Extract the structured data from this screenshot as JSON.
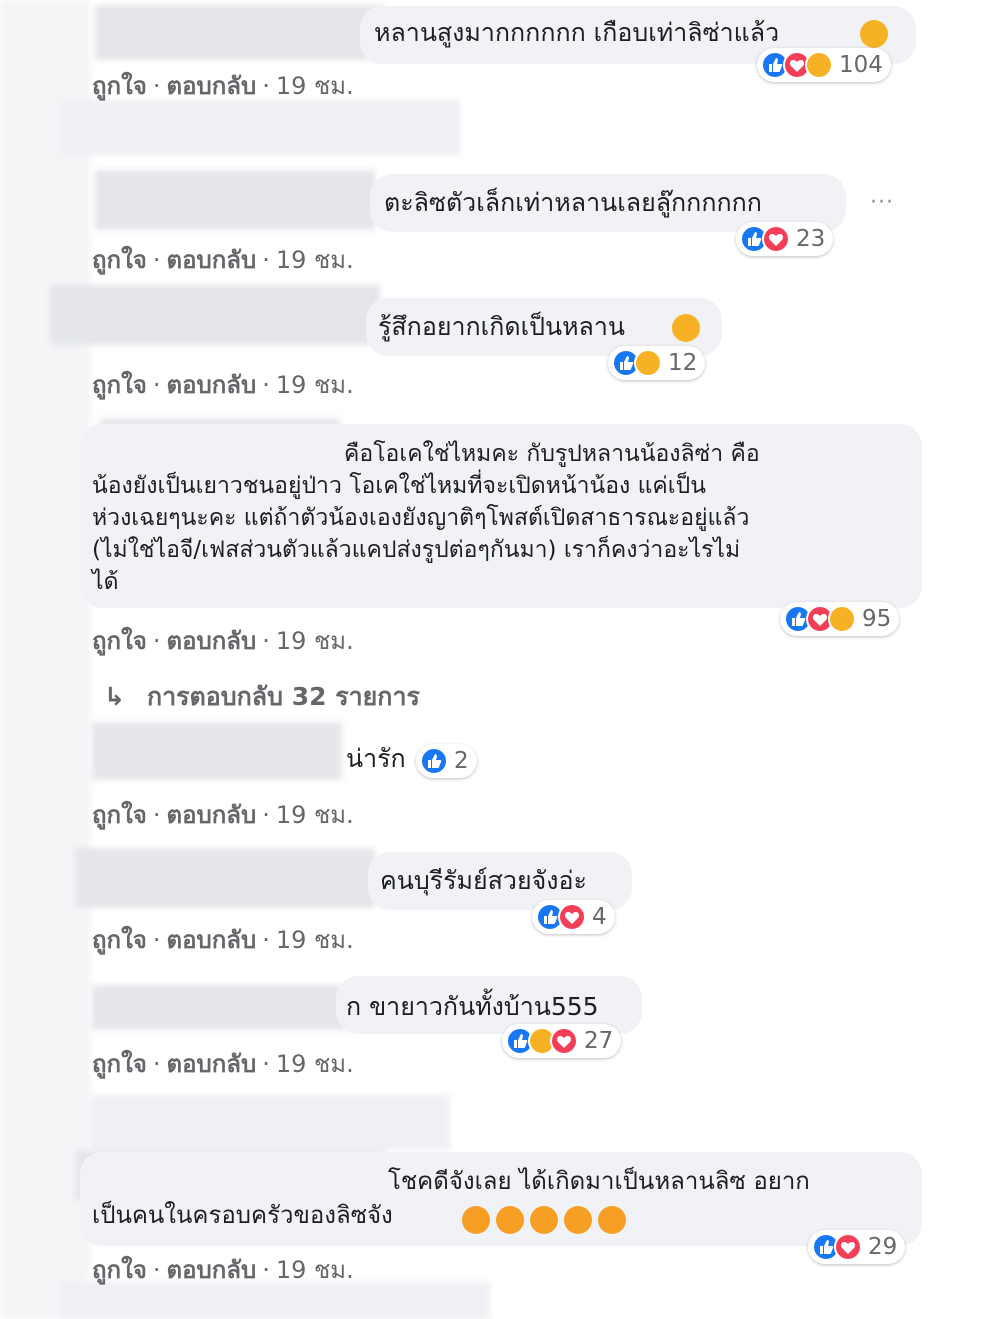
{
  "meta_labels": {
    "like": "ถูกใจ",
    "reply": "ตอบกลับ",
    "dot": "·",
    "time": "19 ชม."
  },
  "comments": [
    {
      "text": "หลานสูงมากกกกกก เกือบเท่าลิซ่าแล้ว",
      "emoji": "heart-eyes",
      "reactions": [
        "like",
        "love",
        "haha"
      ],
      "count": "104"
    },
    {
      "text": "ตะลิซตัวเล็กเท่าหลานเลยลู๊กกกกกก",
      "reactions": [
        "like",
        "love"
      ],
      "count": "23",
      "more": "···"
    },
    {
      "text": "รู้สึกอยากเกิดเป็นหลาน",
      "emoji": "laughing",
      "reactions": [
        "like",
        "haha"
      ],
      "count": "12"
    },
    {
      "text": "คือโอเคใช่ไหมคะ กับรูปหลานน้องลิซ่า คือ\nน้องยังเป็นเยาวชนอยู่ป่าว โอเคใช่ไหมที่จะเปิดหน้าน้อง แค่เป็น\nห่วงเฉยๆนะคะ แต่ถ้าตัวน้องเองยังญาติๆโพสต์เปิดสาธารณะอยู่แล้ว\n(ไม่ใช่ไอจี/เฟสส่วนตัวแล้วแคปส่งรูปต่อๆกันมา) เราก็คงว่าอะไรไม่\nได้",
      "reactions": [
        "like",
        "love",
        "haha"
      ],
      "count": "95"
    },
    {
      "text": "น่ารัก",
      "reactions": [
        "like"
      ],
      "count": "2"
    },
    {
      "text": "คนบุรีรัมย์สวยจังอ่ะ",
      "reactions": [
        "like",
        "love"
      ],
      "count": "4"
    },
    {
      "text": "ก ขายาวกันทั้งบ้าน555",
      "reactions": [
        "like",
        "haha",
        "love"
      ],
      "count": "27"
    },
    {
      "text": "โชคดีจังเลย ได้เกิดมาเป็นหลานลิซ อยาก\nเป็นคนในครอบครัวของลิซจัง",
      "emoji": "smiling-hearts x5",
      "reactions": [
        "like",
        "love"
      ],
      "count": "29"
    }
  ],
  "replies_link": {
    "arrow": "↳",
    "label": "การตอบกลับ 32 รายการ"
  }
}
